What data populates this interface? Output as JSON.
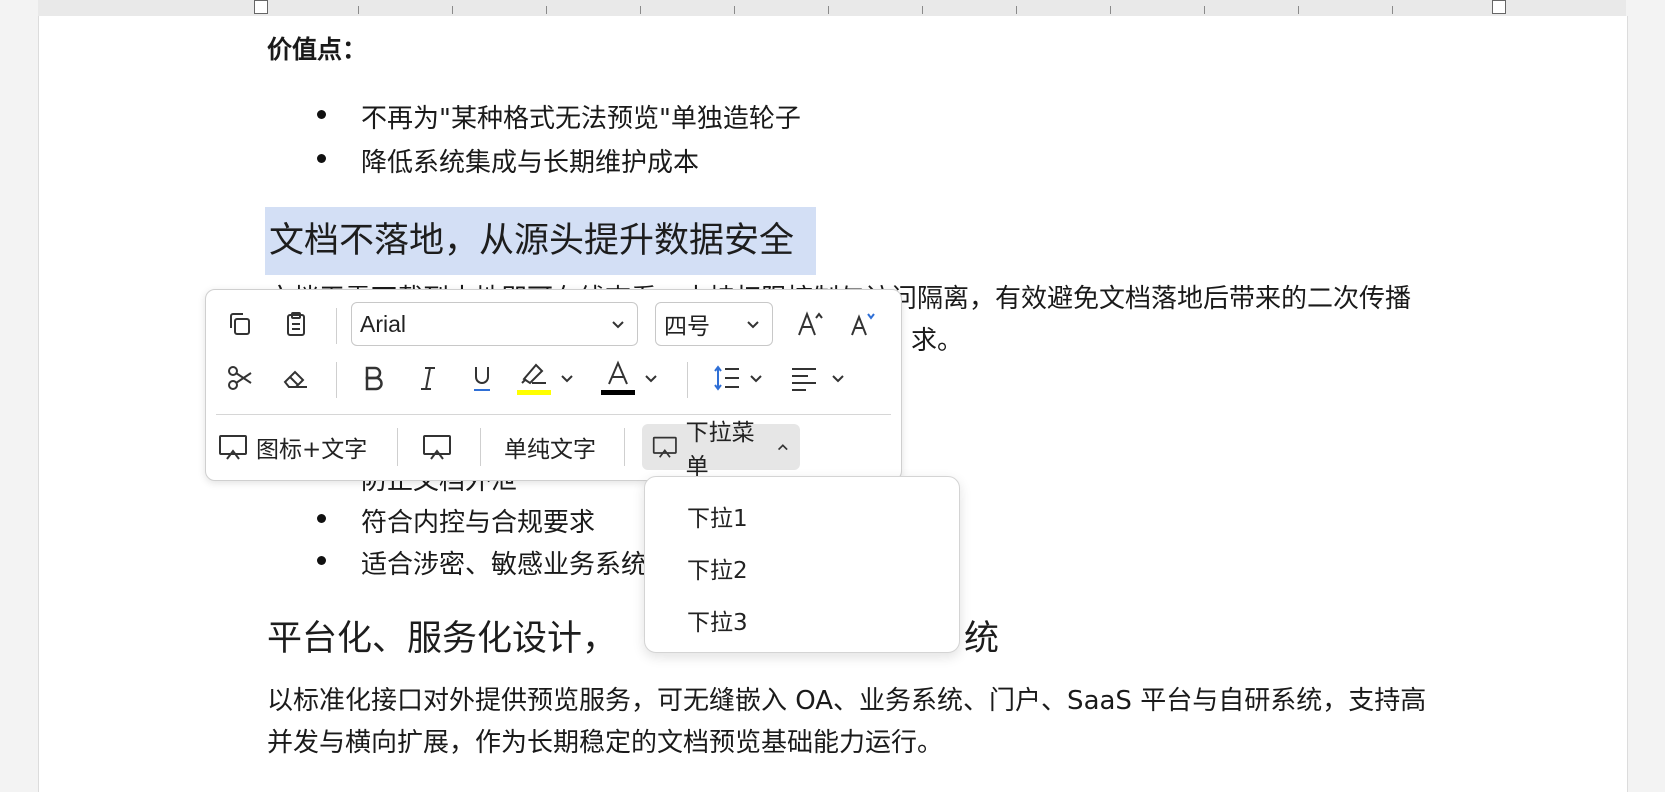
{
  "document": {
    "value_label": "价值点：",
    "bullets_top": [
      "不再为\"某种格式无法预览\"单独造轮子",
      "降低系统集成与长期维护成本"
    ],
    "heading_selected": "文档不落地，从源头提升数据安全",
    "para_security_line1": "文档无需下载到本地即可在线查看，支持权限控制与访问隔离，有效避免文档落地后带来的二次传播",
    "para_security_line2": "求。",
    "bullet_hidden_partial": "防止文档外泄",
    "bullets_bottom": [
      "符合内控与合规要求",
      "适合涉密、敏感业务系统"
    ],
    "heading_platform_left": "平台化、服务化设计，",
    "heading_platform_right": "统",
    "para_platform_line1": "以标准化接口对外提供预览服务，可无缝嵌入 OA、业务系统、门户、SaaS 平台与自研系统，支持高",
    "para_platform_line2": "并发与横向扩展，作为长期稳定的文档预览基础能力运行。"
  },
  "toolbar": {
    "font_name": "Arial",
    "font_size": "四号",
    "highlight_color": "#ffff00",
    "font_color": "#000000",
    "mode_buttons": {
      "icon_text": "图标+文字",
      "text_only": "单纯文字",
      "dropdown_menu": "下拉菜单"
    }
  },
  "dropdown": {
    "items": [
      "下拉1",
      "下拉2",
      "下拉3"
    ]
  }
}
